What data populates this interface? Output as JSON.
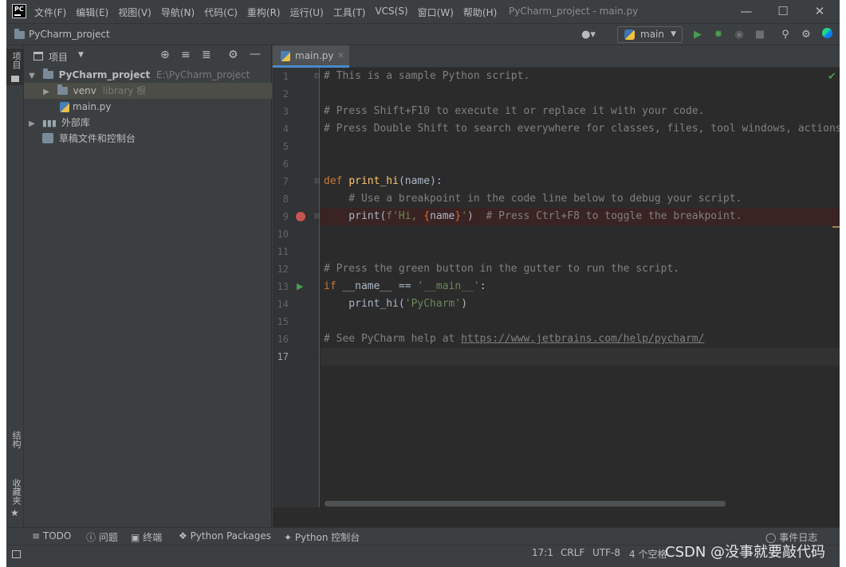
{
  "window": {
    "title": "PyCharm_project - main.py",
    "logo": "PC",
    "controls": {
      "minimize": "—",
      "maximize": "☐",
      "close": "✕"
    }
  },
  "menu": [
    "文件(F)",
    "编辑(E)",
    "视图(V)",
    "导航(N)",
    "代码(C)",
    "重构(R)",
    "运行(U)",
    "工具(T)",
    "VCS(S)",
    "窗口(W)",
    "帮助(H)"
  ],
  "navbar": {
    "project": "PyCharm_project",
    "branch": "main",
    "icons": [
      "user-icon",
      "run-icon",
      "debug-icon",
      "coverage-icon",
      "stop-icon",
      "search-icon",
      "gear-icon",
      "jetbrains-logo-icon"
    ]
  },
  "left_strip": {
    "project_tab": "项目",
    "structure_tab": "结构",
    "favorites_tab": "收藏夹"
  },
  "project_panel": {
    "title": "项目",
    "tree": [
      {
        "label": "PyCharm_project",
        "extra": "E:\\PyCharm_project",
        "icon": "folder-icon",
        "expanded": true
      },
      {
        "label": "venv",
        "extra": "library 根",
        "icon": "folder-icon",
        "expanded": false
      },
      {
        "label": "main.py",
        "extra": "",
        "icon": "python-file-icon"
      },
      {
        "label": "外部库",
        "extra": "",
        "icon": "library-icon",
        "expanded": false
      },
      {
        "label": "草稿文件和控制台",
        "extra": "",
        "icon": "scratch-icon"
      }
    ]
  },
  "editor": {
    "tab": "main.py",
    "line_numbers": [
      "1",
      "2",
      "3",
      "4",
      "5",
      "6",
      "7",
      "8",
      "9",
      "10",
      "11",
      "12",
      "13",
      "14",
      "15",
      "16",
      "17"
    ],
    "code": {
      "l1": "# This is a sample Python script.",
      "l3": "# Press Shift+F10 to execute it or replace it with your code.",
      "l4": "# Press Double Shift to search everywhere for classes, files, tool windows, actions, and settings.",
      "l7_kw": "def ",
      "l7_fn": "print_hi",
      "l7_rest": "(name):",
      "l8": "    # Use a breakpoint in the code line below to debug your script.",
      "l9_a": "    print(",
      "l9_str1": "f'Hi, ",
      "l9_brace1": "{",
      "l9_name": "name",
      "l9_brace2": "}",
      "l9_str2": "'",
      "l9_b": ")  ",
      "l9_cmt": "# Press Ctrl+F8 to toggle the breakpoint.",
      "l12": "# Press the green button in the gutter to run the script.",
      "l13_kw": "if ",
      "l13_a": "__name__ == ",
      "l13_str": "'__main__'",
      "l13_b": ":",
      "l14_a": "    print_hi(",
      "l14_str": "'PyCharm'",
      "l14_b": ")",
      "l16_cmt": "# See PyCharm help at ",
      "l16_url": "https://www.jetbrains.com/help/pycharm/"
    }
  },
  "bottom_tools": [
    "TODO",
    "问题",
    "终端",
    "Python Packages",
    "Python 控制台",
    "事件日志"
  ],
  "status": {
    "position": "17:1",
    "line_sep": "CRLF",
    "encoding": "UTF-8",
    "indent": "4 个空格"
  },
  "watermark": "CSDN @没事就要敲代码"
}
